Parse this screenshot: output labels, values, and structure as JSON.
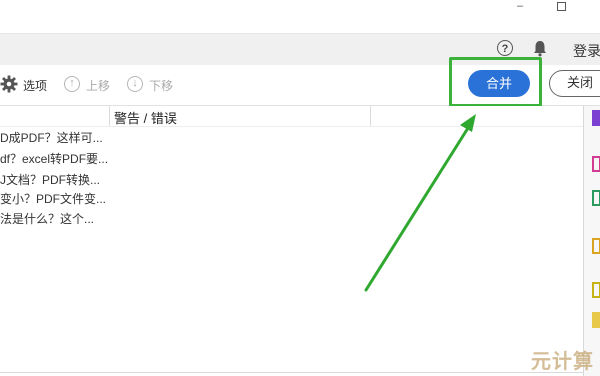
{
  "window": {
    "minimize_label": "–"
  },
  "account_bar": {
    "help_icon": "help-circle-icon",
    "help_glyph": "?",
    "bell_icon": "bell-icon",
    "login_label": "登录"
  },
  "toolbar": {
    "options_label": "选项",
    "up_label": "上移",
    "down_label": "下移",
    "up_glyph": "↑",
    "down_glyph": "↓",
    "merge_label": "合并",
    "close_label": "关闭"
  },
  "table": {
    "columns": [
      "警告 / 错误"
    ],
    "rows": [
      "D成PDF？这样可...",
      "df？excel转PDF要...",
      "J文档？PDF转换...",
      "变小？PDF文件变...",
      "法是什么？这个..."
    ]
  },
  "annotation": {
    "highlight_color": "#3bb33b",
    "arrow_color": "#2ea82e"
  },
  "watermark": {
    "text": "元计算"
  },
  "colors": {
    "merge_button": "#2b72d8",
    "side_icons": [
      "#7b3fd1",
      "#d23b8f",
      "#2b9a5e",
      "#d9a521",
      "#c7b316"
    ]
  }
}
